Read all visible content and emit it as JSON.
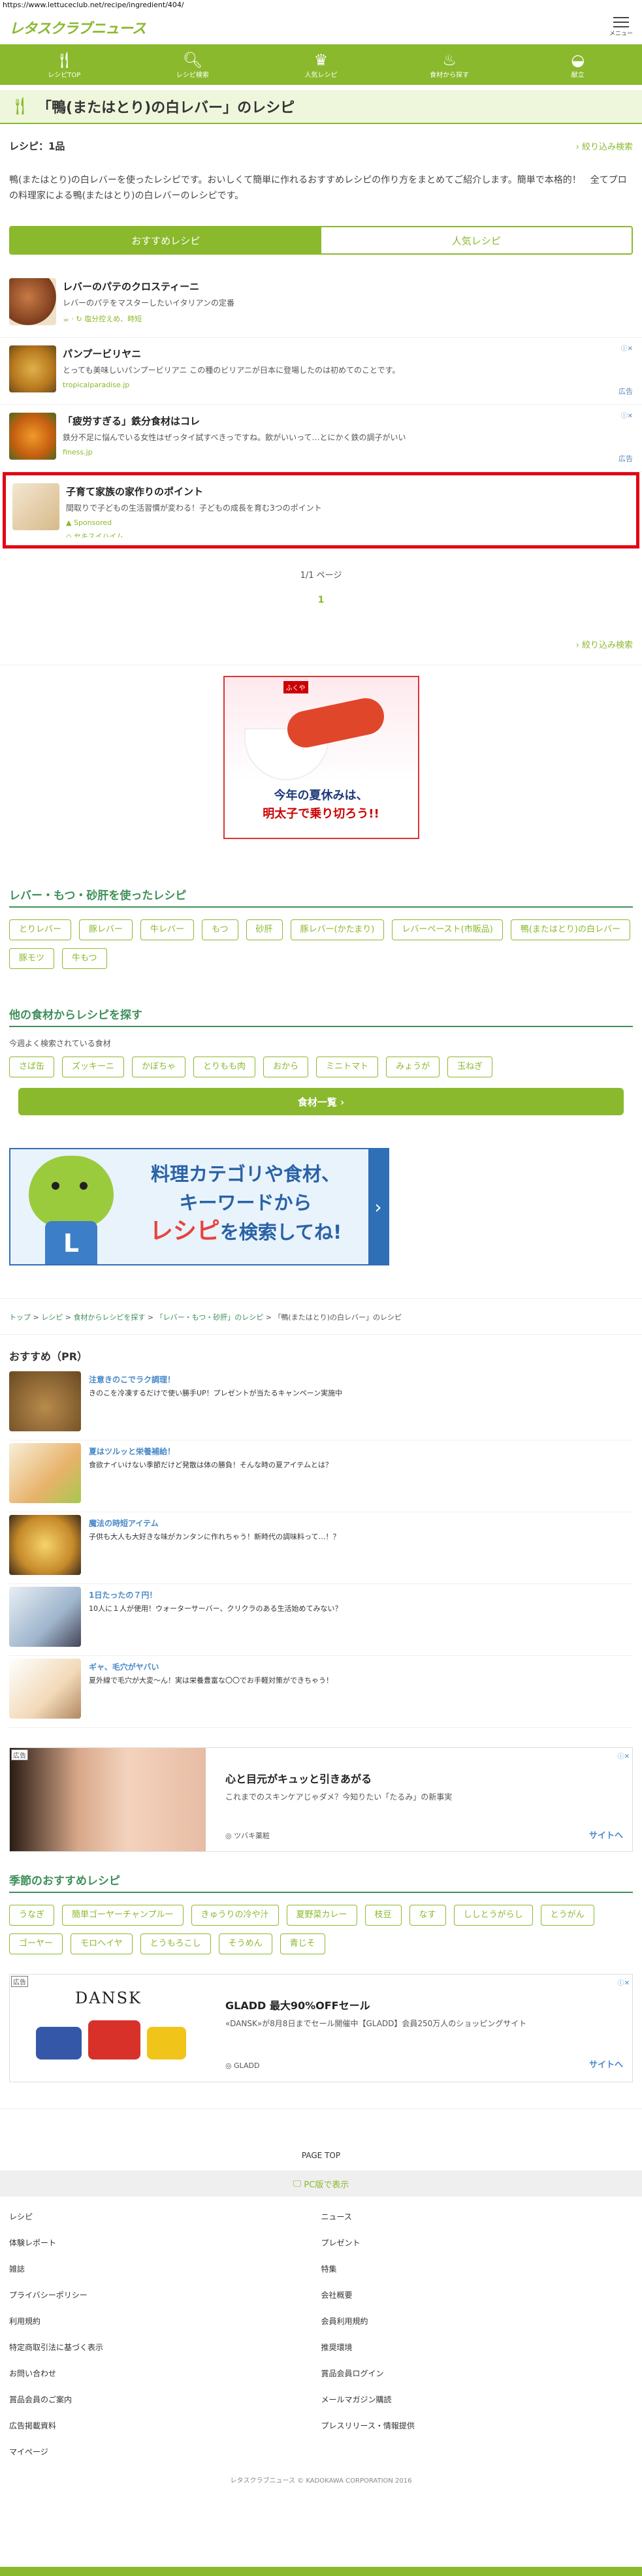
{
  "url": "https://www.lettuceclub.net/recipe/ingredient/404/",
  "header": {
    "logo": "レタスクラブニュース",
    "menu_label": "メニュー"
  },
  "catnav": [
    {
      "label": "レシピTOP",
      "icon": "fork-knife-icon"
    },
    {
      "label": "レシピ検索",
      "icon": "search-icon"
    },
    {
      "label": "人気レシピ",
      "icon": "crown-icon"
    },
    {
      "label": "食材から探す",
      "icon": "pot-icon"
    },
    {
      "label": "献立",
      "icon": "bento-icon"
    }
  ],
  "page": {
    "title": "「鴨(またはとり)の白レバー」のレシピ",
    "count": "レシピ：1品",
    "filter": "絞り込み検索",
    "description": "鴨(またはとり)の白レバーを使ったレシピです。おいしくて簡単に作れるおすすめレシピの作り方をまとめてご紹介します。簡単で本格的！　全てプロの料理家による鴨(またはとり)の白レバーのレシピです。",
    "tabs": [
      "おすすめレシピ",
      "人気レシピ"
    ]
  },
  "recipes": [
    {
      "title": "レバーのパテのクロスティーニ",
      "desc": "レバーのパテをマスターしたいイタリアンの定番",
      "sub": "塩分控えめ、時短",
      "ad": ""
    },
    {
      "title": "パンプービリヤニ",
      "desc": "とっても美味しいパンプービリアニ この種のビリアニが日本に登場したのは初めてのことです。",
      "sub": "tropicalparadise.jp",
      "ad": "広告"
    },
    {
      "title": "「疲労すぎる」鉄分食材はコレ",
      "desc": "鉄分不足に悩んでいる女性はぜっタイ試すべきっですね。飲がいいって…とにかく鉄の調子がいい",
      "sub": "finess.jp",
      "ad": "広告"
    },
    {
      "title": "子育て家族の家作りのポイント",
      "desc": "間取りで子どもの生活習慣が変わる！子どもの成長を育む3つのポイント",
      "sub": "Sponsored",
      "sub2": "セキスイハイム",
      "ad": ""
    }
  ],
  "pager": {
    "text": "1/1 ページ",
    "current": "1"
  },
  "filter2": "絞り込み検索",
  "banner_ad": {
    "brand": "ふくや",
    "line1": "今年の夏休みは、",
    "line2": "明太子で乗り切ろう!!"
  },
  "liver_section": {
    "heading": "レバー・もつ・砂肝を使ったレシピ",
    "tags": [
      "とりレバー",
      "豚レバー",
      "牛レバー",
      "もつ",
      "砂肝",
      "豚レバー(かたまり)",
      "レバーペースト(市販品)",
      "鴨(またはとり)の白レバー",
      "豚モツ",
      "牛もつ"
    ]
  },
  "other_section": {
    "heading": "他の食材からレシピを探す",
    "popular_label": "今週よく検索されている食材",
    "tags": [
      "さば缶",
      "ズッキーニ",
      "かぼちゃ",
      "とりもも肉",
      "おから",
      "ミニトマト",
      "みょうが",
      "玉ねぎ"
    ],
    "button": "食材一覧 ›"
  },
  "search_banner": {
    "line1": "料理カテゴリや食材、",
    "line2": "キーワードから",
    "line3a": "レシピ",
    "line3b": "を検索してね!",
    "mascot_letter": "L"
  },
  "breadcrumb": {
    "items": [
      "トップ",
      "レシピ",
      "食材からレシピを探す",
      "「レバー・もつ・砂肝」のレシピ"
    ],
    "current": "「鴨(またはとり)の白レバー」のレシピ"
  },
  "pr": {
    "heading": "おすすめ（PR）",
    "items": [
      {
        "title": "注意きのこでラク調理！",
        "desc": "きのこを冷凍するだけで使い勝手UP！プレゼントが当たるキャンペーン実施中"
      },
      {
        "title": "夏はツルッと栄養補給！",
        "desc": "食欲ナイいけない季節だけど発散は体の勝負！そんな時の夏アイテムとは？"
      },
      {
        "title": "魔法の時短アイテム",
        "desc": "子供も大人も大好きな味がカンタンに作れちゃう！新時代の調味料って…！？"
      },
      {
        "title": "1日たったの７円！",
        "desc": "10人に１人が使用！ウォーターサーバー、クリクラのある生活始めてみない？"
      },
      {
        "title": "ギャ、毛穴がヤバい",
        "desc": "夏外線で毛穴が大変〜ん！実は栄養豊富な〇〇でお手軽対策ができちゃう！"
      }
    ]
  },
  "ad1": {
    "label": "広告",
    "title": "心と目元がキュッと引きあがる",
    "desc": "これまでのスキンケアじゃダメ？今知りたい「たるみ」の新事実",
    "source": "ツバキ薬粧",
    "cta": "サイトへ"
  },
  "seasonal": {
    "heading": "季節のおすすめレシピ",
    "tags": [
      "うなぎ",
      "簡単ゴーヤーチャンプルー",
      "きゅうりの冷や汁",
      "夏野菜カレー",
      "枝豆",
      "なす",
      "ししとうがらし",
      "とうがん",
      "ゴーヤー",
      "モロヘイヤ",
      "とうもろこし",
      "そうめん",
      "青じそ"
    ]
  },
  "ad2": {
    "label": "広告",
    "logo": "DANSK",
    "title": "GLADD 最大90%OFFセール",
    "desc": "«DANSK»が8月8日までセール開催中【GLADD】会員250万人のショッピングサイト",
    "source": "GLADD",
    "cta": "サイトへ"
  },
  "footer": {
    "pagetop": "PAGE TOP",
    "pc": "PC版で表示",
    "links": [
      "レシピ",
      "ニュース",
      "体験レポート",
      "プレゼント",
      "雑誌",
      "特集",
      "プライバシーポリシー",
      "会社概要",
      "利用規約",
      "会員利用規約",
      "特定商取引法に基づく表示",
      "推奨環境",
      "お問い合わせ",
      "賞品会員ログイン",
      "賞品会員のご案内",
      "メールマガジン購読",
      "広告掲載資料",
      "プレスリリース・情報提供",
      "マイページ"
    ],
    "copyright": "レタスクラブニュース © KADOKAWA CORPORATION 2016"
  },
  "colors": {
    "brand": "#8ab92d",
    "heading": "#3f8f5a",
    "highlight": "#e30613",
    "link": "#4a89c8"
  }
}
